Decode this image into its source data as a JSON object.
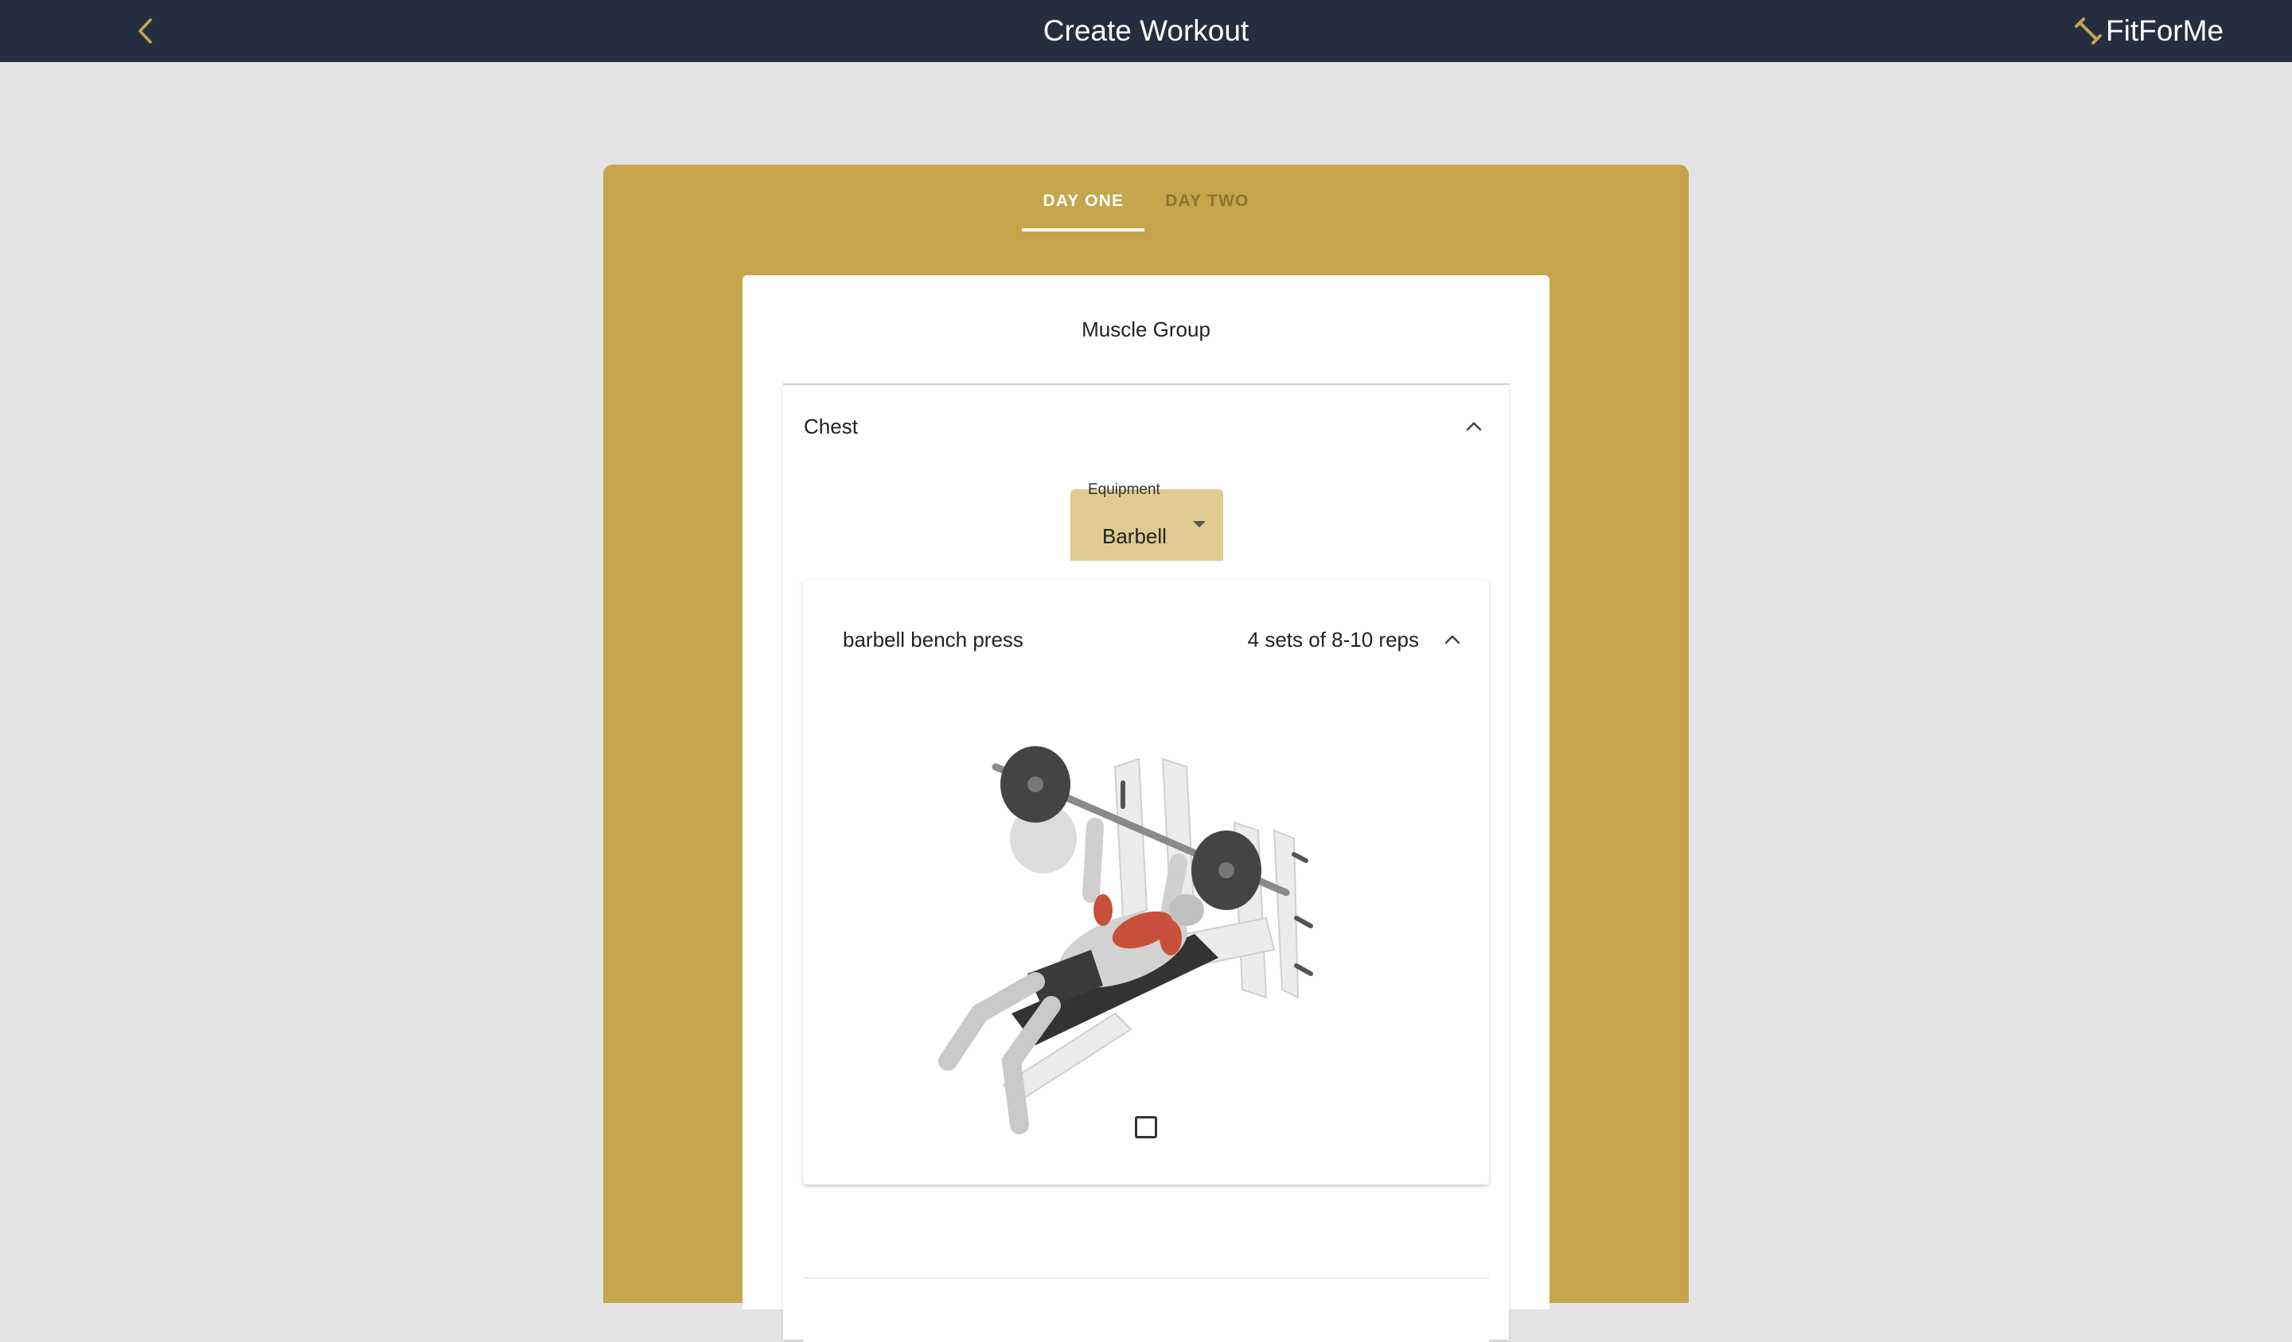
{
  "header": {
    "title": "Create Workout",
    "brand": "FitForMe",
    "back_icon": "chevron-left-icon",
    "brand_icon": "dumbbell-icon",
    "background": "#252e41",
    "accent": "#c5a64d"
  },
  "tabs": [
    {
      "label": "DAY ONE",
      "active": true
    },
    {
      "label": "DAY TWO",
      "active": false
    }
  ],
  "section": {
    "heading": "Muscle Group",
    "group": {
      "title": "Chest",
      "expanded": true,
      "equipment": {
        "label": "Equipment",
        "value": "Barbell"
      },
      "exercises": [
        {
          "name": "barbell bench press",
          "sets": "4 sets of 8-10 reps",
          "expanded": true,
          "image": "bench-press-illustration"
        }
      ]
    },
    "checkbox_checked": false
  }
}
